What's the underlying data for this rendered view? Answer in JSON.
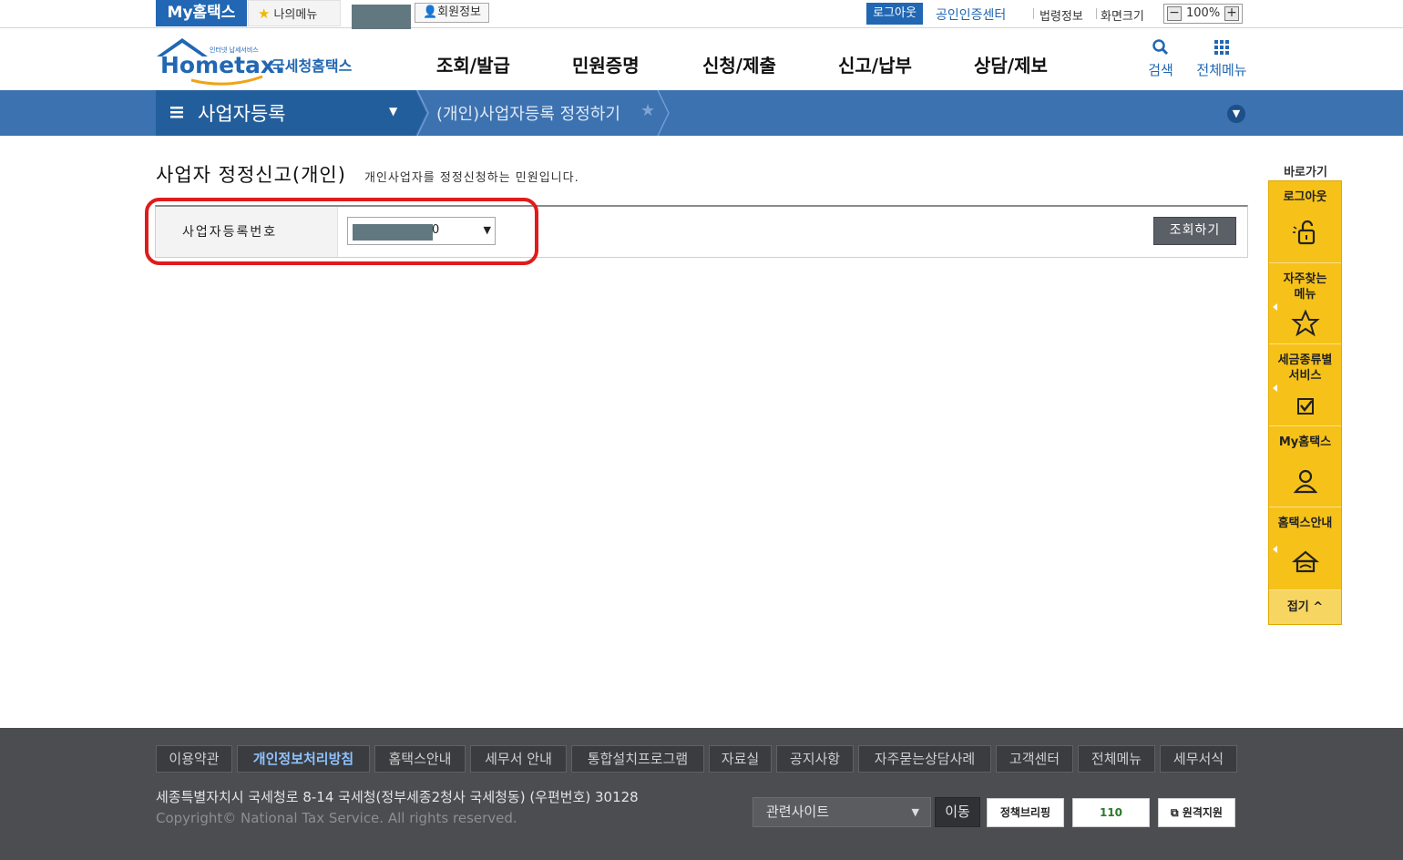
{
  "topbar": {
    "my_hometax": "My홈택스",
    "my_menu": "나의메뉴",
    "member_info": "회원정보",
    "logout": "로그아웃",
    "cert_center": "공인인증센터",
    "law_info": "법령정보",
    "screen_size": "화면크기",
    "zoom": "100%",
    "zoom_minus": "−",
    "zoom_plus": "+"
  },
  "header": {
    "logo_tagline": "인터넷 납세서비스",
    "logo_main": "Hometax.",
    "logo_sub": "국세청홈택스",
    "nav": [
      "조회/발급",
      "민원증명",
      "신청/제출",
      "신고/납부",
      "상담/제보"
    ],
    "search": "검색",
    "all_menu": "전체메뉴"
  },
  "navbar": {
    "section": "사업자등록",
    "sub": "(개인)사업자등록 정정하기"
  },
  "content": {
    "title": "사업자 정정신고(개인)",
    "description": "개인사업자를 정정신청하는 민원입니다.",
    "field_label": "사업자등록번호",
    "field_value": "0",
    "lookup_button": "조회하기"
  },
  "quick_menu": {
    "title": "바로가기",
    "items": [
      "로그아웃",
      "자주찾는\n메뉴",
      "세금종류별\n서비스",
      "My홈택스",
      "홈택스안내"
    ],
    "fold": "접기"
  },
  "footer": {
    "links": [
      "이용약관",
      "개인정보처리방침",
      "홈택스안내",
      "세무서 안내",
      "통합설치프로그램",
      "자료실",
      "공지사항",
      "자주묻는상담사례",
      "고객센터",
      "전체메뉴",
      "세무서식"
    ],
    "address": "세종특별자치시 국세청로 8-14 국세청(정부세종2청사 국세청동) (우편번호) 30128",
    "copyright": "Copyright© National Tax Service. All rights reserved.",
    "related_site": "관련사이트",
    "go": "이동",
    "badges": [
      "정책브리핑",
      "110",
      "원격지원"
    ]
  },
  "colors": {
    "brand_blue": "#2167b3",
    "nav_bar": "#3d72b0",
    "quick_yellow": "#f6c21a",
    "highlight_red": "#e11b1b",
    "footer_bg": "#4b4d51"
  }
}
